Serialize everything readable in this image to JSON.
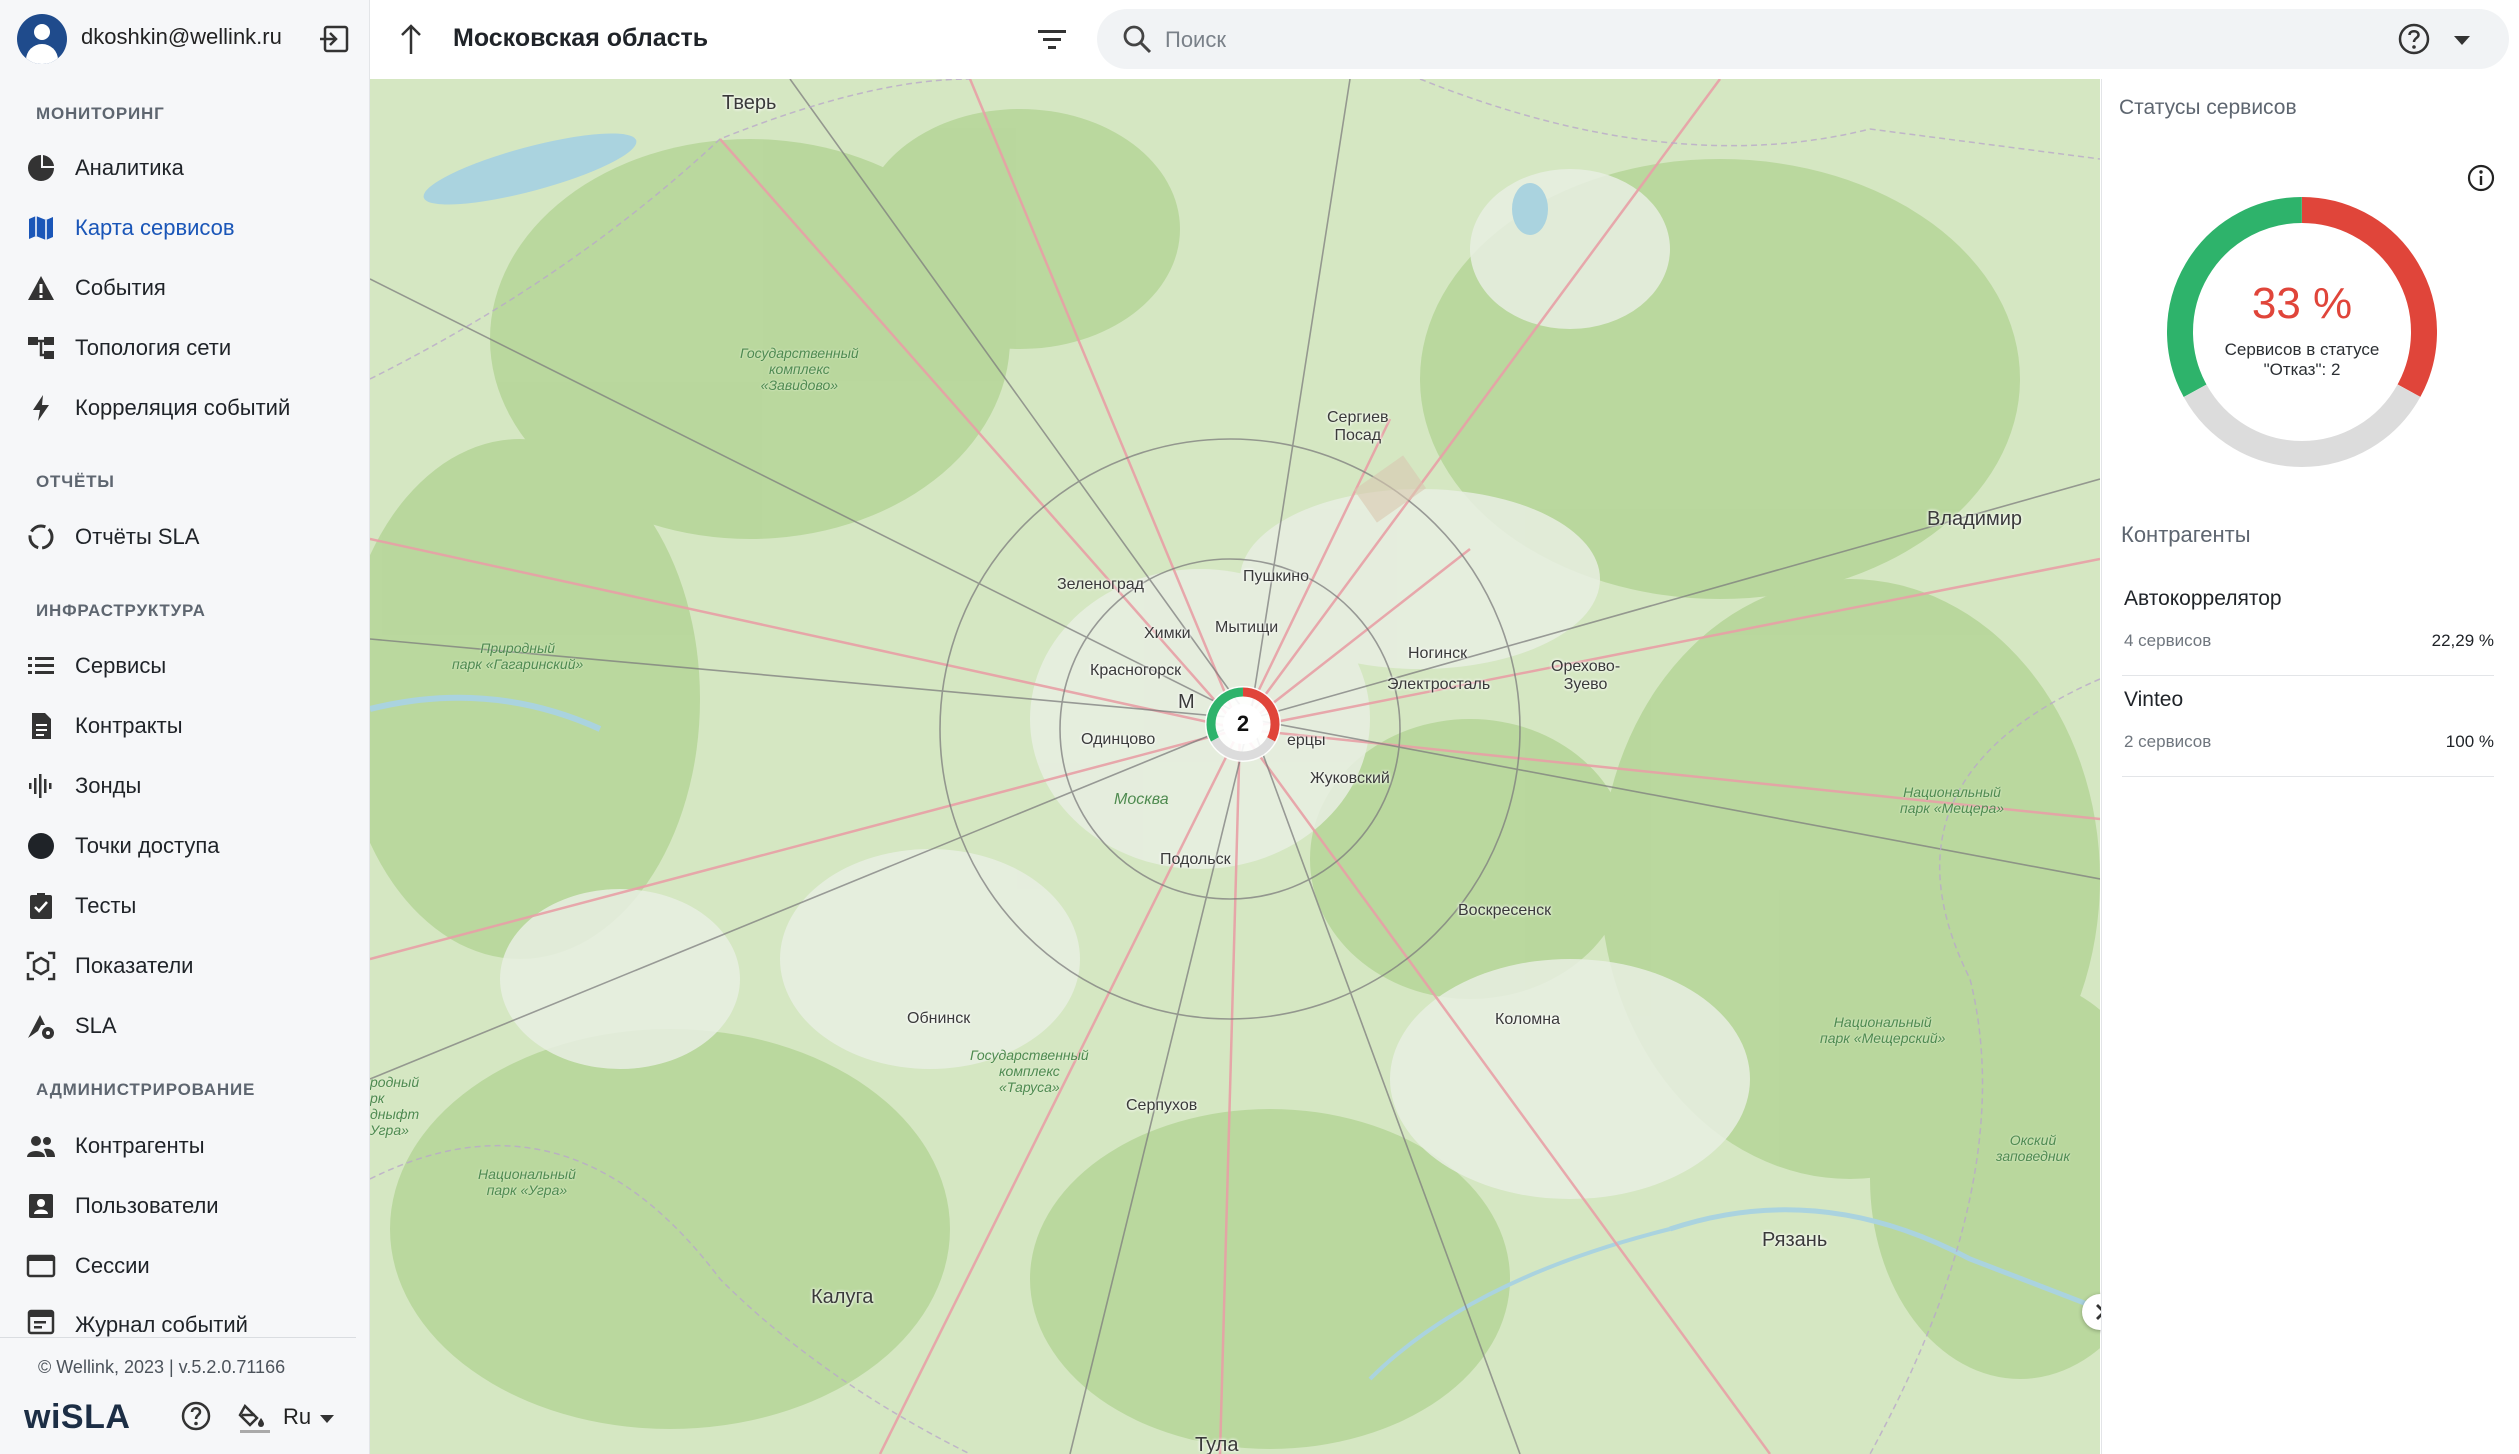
{
  "user": {
    "email": "dkoshkin@wellink.ru"
  },
  "sections": {
    "monitoring": "МОНИТОРИНГ",
    "reports": "ОТЧЁТЫ",
    "infrastructure": "ИНФРАСТРУКТУРА",
    "administration": "АДМИНИСТРИРОВАНИЕ"
  },
  "nav": {
    "analytics": "Аналитика",
    "service_map": "Карта сервисов",
    "events": "События",
    "topology": "Топология сети",
    "correlation": "Корреляция событий",
    "sla_reports": "Отчёты SLA",
    "services": "Сервисы",
    "contracts": "Контракты",
    "probes": "Зонды",
    "access_points": "Точки доступа",
    "tests": "Тесты",
    "indicators": "Показатели",
    "sla": "SLA",
    "counterparties": "Контрагенты",
    "users": "Пользователи",
    "sessions": "Сессии",
    "event_log": "Журнал событий"
  },
  "footer": {
    "copyright": "© Wellink, 2023 | v.5.2.0.71166",
    "logo": "wiSLA",
    "language": "Ru"
  },
  "topbar": {
    "region": "Московская область",
    "search_placeholder": "Поиск"
  },
  "map": {
    "cluster_count": "2",
    "cities": {
      "tver": "Тверь",
      "sergiev_posad": "Сергиев\nПосад",
      "vladimir": "Владимир",
      "zelenograd": "Зеленоград",
      "pushkino": "Пушкино",
      "khimki": "Химки",
      "mytishchi": "Мытищи",
      "krasnogorsk": "Красногорск",
      "noginsk": "Ногинск",
      "elektrostal": "Электросталь",
      "orekhovo": "Орехово-\nЗуево",
      "odintsovo": "Одинцово",
      "lyubertsy": "ерцы",
      "moskva": "Москва",
      "m_label": "М",
      "zhukovsky": "Жуковский",
      "podolsk": "Подольск",
      "voskresensk": "Воскресенск",
      "obninsk": "Обнинск",
      "kolomna": "Коломна",
      "serpukhov": "Серпухов",
      "ryazan": "Рязань",
      "kaluga": "Калуга",
      "tula": "Тула"
    },
    "parks": {
      "zavidovo": "Государственный\nкомплекс\n«Завидово»",
      "gagarinsky": "Природный\nпарк «Гагаринский»",
      "meshchera": "Национальный\nпарк «Мещера»",
      "meshchersky": "Национальный\nпарк «Мещерский»",
      "tarusa": "Государственный\nкомплекс\n«Таруса»",
      "ugra": "Национальный\nпарк «Угра»",
      "oksky": "Окский\nзаповедник",
      "left_edge": "родный\nрк\nдныфт\nУгра»"
    }
  },
  "panel": {
    "title": "Статусы сервисов",
    "donut": {
      "percent": "33 %",
      "caption": "Сервисов в статусе \"Отказ\": 2",
      "segments": {
        "ok_fraction": 0.33,
        "fail_fraction": 0.33,
        "unknown_fraction": 0.34
      },
      "colors": {
        "ok": "#2eb36b",
        "fail": "#e0453a",
        "unknown": "#dcdcdc"
      }
    },
    "counterparties_title": "Контрагенты",
    "counterparties": [
      {
        "name": "Автокоррелятор",
        "count": "4 сервисов",
        "percent": "22,29 %"
      },
      {
        "name": "Vinteo",
        "count": "2 сервисов",
        "percent": "100 %"
      }
    ]
  }
}
